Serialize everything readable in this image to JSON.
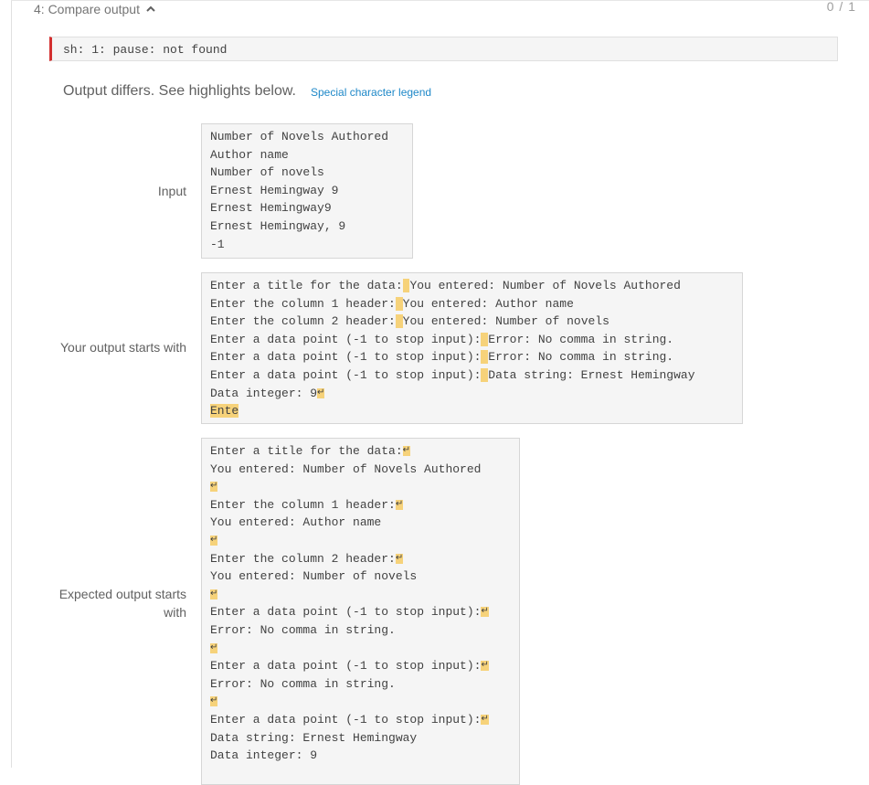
{
  "header": {
    "title": "4: Compare output",
    "score": "0 / 1"
  },
  "error_message": "sh: 1: pause: not found",
  "differs_text": "Output differs. See highlights below.",
  "legend_link": "Special character legend",
  "input": {
    "label": "Input",
    "lines": [
      "Number of Novels Authored",
      "Author name",
      "Number of novels",
      "Ernest Hemingway 9",
      "Ernest Hemingway9",
      "Ernest Hemingway, 9",
      "-1"
    ]
  },
  "your_output": {
    "label": "Your output starts with",
    "lines": [
      {
        "normal": "Enter a title for the data:",
        "hl": " ",
        "rest": "You entered: Number of Novels Authored"
      },
      {
        "normal": "Enter the column 1 header:",
        "hl": " ",
        "rest": "You entered: Author name"
      },
      {
        "normal": "Enter the column 2 header:",
        "hl": " ",
        "rest": "You entered: Number of novels"
      },
      {
        "normal": "Enter a data point (-1 to stop input):",
        "hl": " ",
        "rest": "Error: No comma in string."
      },
      {
        "normal": "Enter a data point (-1 to stop input):",
        "hl": " ",
        "rest": "Error: No comma in string."
      },
      {
        "normal": "Enter a data point (-1 to stop input):",
        "hl": " ",
        "rest": "Data string: Ernest Hemingway"
      },
      {
        "normal": "Data integer: 9",
        "hl": "↵",
        "rest": ""
      },
      {
        "normal": "",
        "hl": "Ente",
        "rest": ""
      }
    ]
  },
  "expected_output": {
    "label_line1": "Expected output starts",
    "label_line2": "with",
    "lines": [
      {
        "normal": "Enter a title for the data:",
        "hl": "↵",
        "rest": ""
      },
      {
        "normal": "You entered: Number of Novels Authored",
        "hl": "",
        "rest": ""
      },
      {
        "normal": "",
        "hl": "↵",
        "rest": ""
      },
      {
        "normal": "Enter the column 1 header:",
        "hl": "↵",
        "rest": ""
      },
      {
        "normal": "You entered: Author name",
        "hl": "",
        "rest": ""
      },
      {
        "normal": "",
        "hl": "↵",
        "rest": ""
      },
      {
        "normal": "Enter the column 2 header:",
        "hl": "↵",
        "rest": ""
      },
      {
        "normal": "You entered: Number of novels",
        "hl": "",
        "rest": ""
      },
      {
        "normal": "",
        "hl": "↵",
        "rest": ""
      },
      {
        "normal": "Enter a data point (-1 to stop input):",
        "hl": "↵",
        "rest": ""
      },
      {
        "normal": "Error: No comma in string.",
        "hl": "",
        "rest": ""
      },
      {
        "normal": "",
        "hl": "↵",
        "rest": ""
      },
      {
        "normal": "Enter a data point (-1 to stop input):",
        "hl": "↵",
        "rest": ""
      },
      {
        "normal": "Error: No comma in string.",
        "hl": "",
        "rest": ""
      },
      {
        "normal": "",
        "hl": "↵",
        "rest": ""
      },
      {
        "normal": "Enter a data point (-1 to stop input):",
        "hl": "↵",
        "rest": ""
      },
      {
        "normal": "Data string: Ernest Hemingway",
        "hl": "",
        "rest": ""
      },
      {
        "normal": "Data integer: 9",
        "hl": "",
        "rest": ""
      }
    ]
  },
  "colors": {
    "highlight": "#f6d27a",
    "error_bar": "#d32f2f",
    "link": "#1e88c8"
  },
  "icons": {
    "collapse": "chevron-up-icon"
  }
}
